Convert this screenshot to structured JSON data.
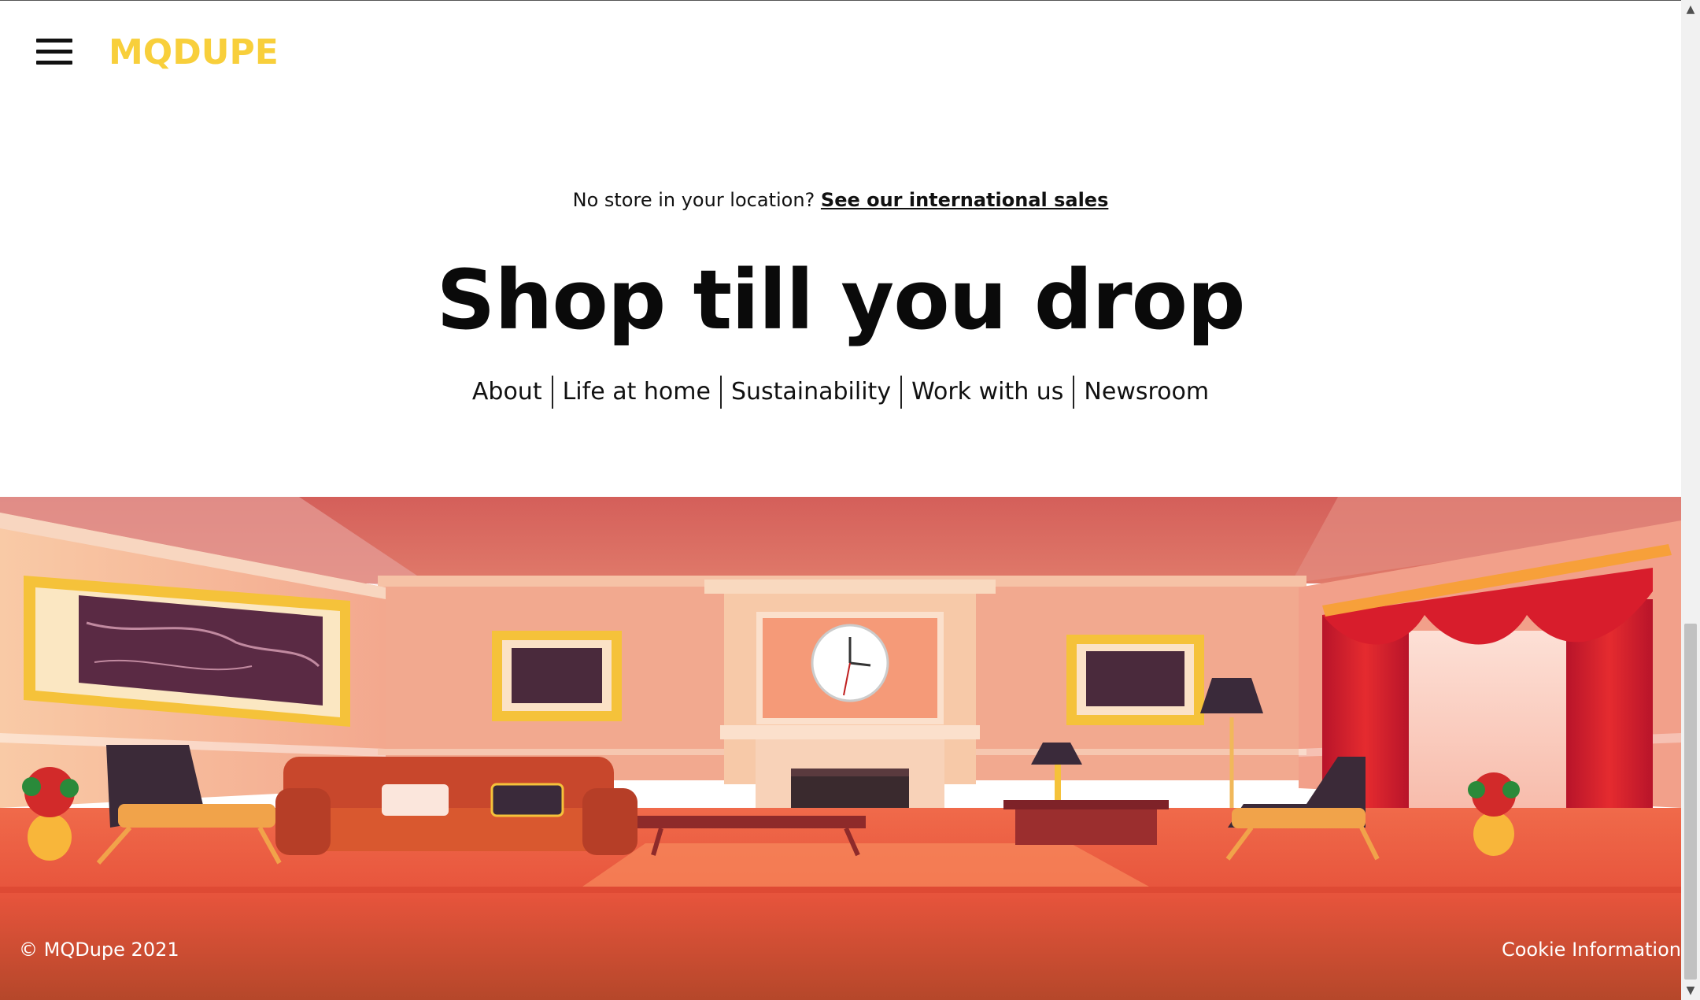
{
  "header": {
    "logo": "MQDUPE",
    "menu_icon": "hamburger-menu-icon"
  },
  "notice": {
    "text": "No store in your location? ",
    "link": "See our international sales"
  },
  "hero": {
    "title": "Shop till you drop"
  },
  "nav": {
    "items": [
      {
        "label": "About"
      },
      {
        "label": "Life at home"
      },
      {
        "label": "Sustainability"
      },
      {
        "label": "Work with us"
      },
      {
        "label": "Newsroom"
      }
    ]
  },
  "footer": {
    "copyright": "© MQDupe 2021",
    "cookie": "Cookie Information"
  },
  "colors": {
    "logo": "#f8cf3b",
    "scene_wall": "#f2a98f",
    "scene_floor": "#e95a3e",
    "curtain": "#d81d2c"
  },
  "scrollbar": {
    "up_icon": "▲",
    "down_icon": "▼"
  }
}
